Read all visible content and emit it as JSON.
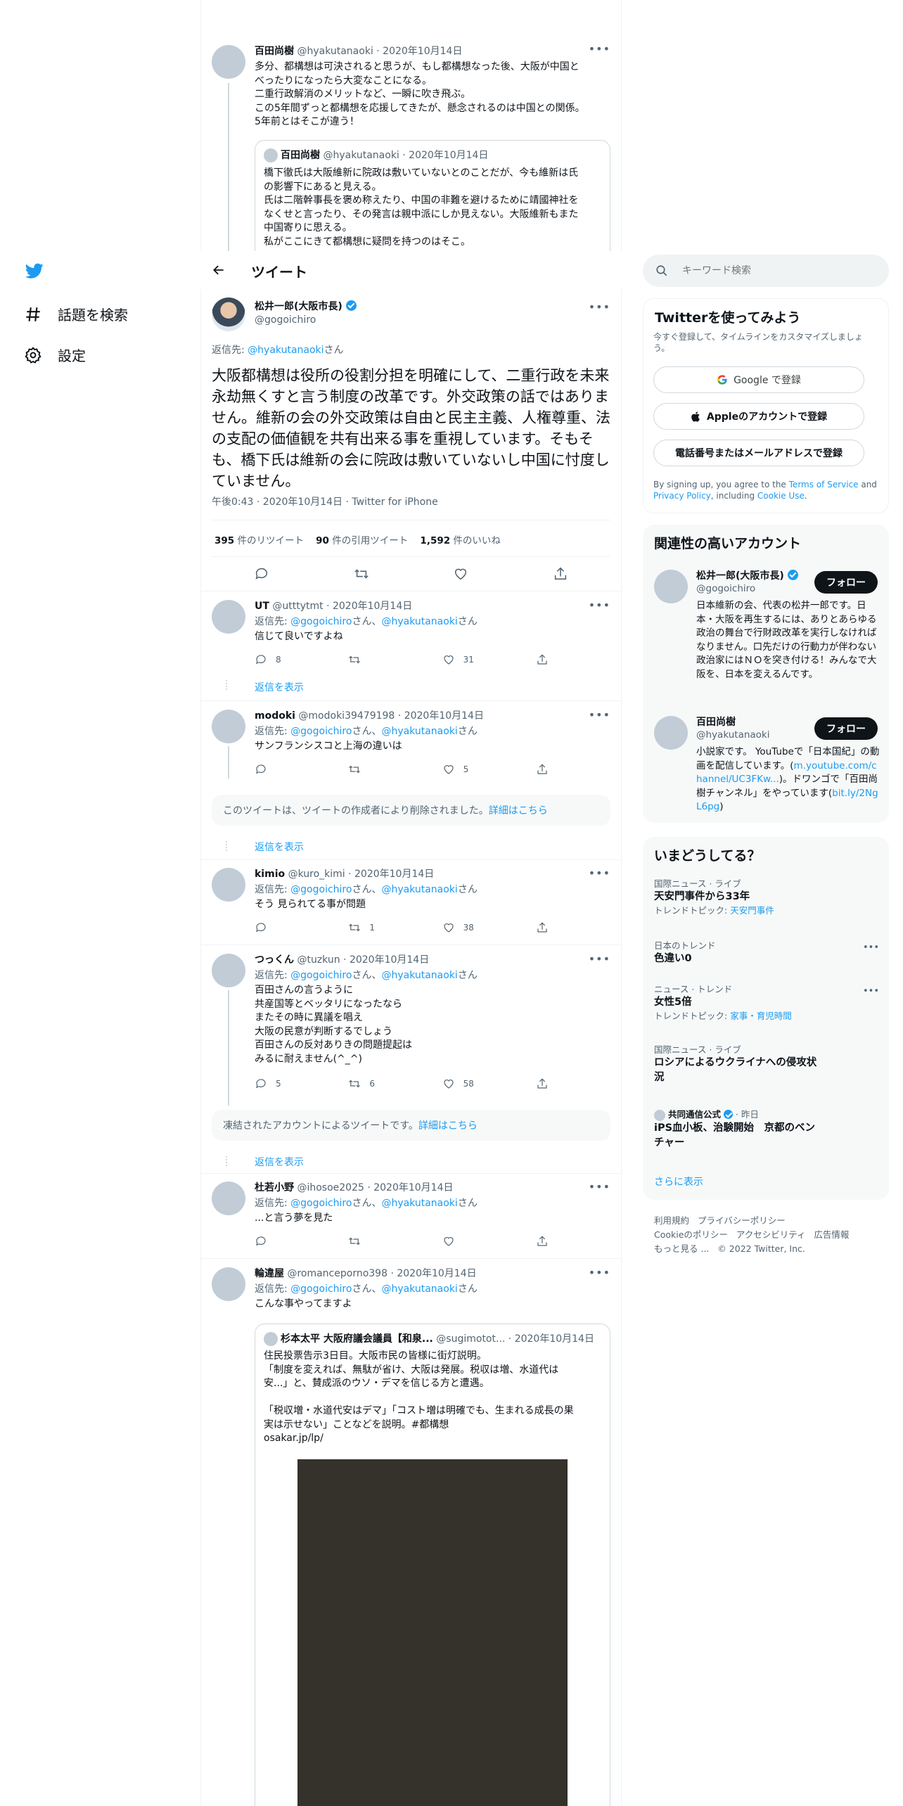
{
  "nav": {
    "explore_label": "話題を検索",
    "settings_label": "設定"
  },
  "header": {
    "title": "ツイート"
  },
  "search": {
    "placeholder": "キーワード検索"
  },
  "parent_tweet": {
    "name": "百田尚樹",
    "handle": "@hyakutanaoki",
    "date": "· 2020年10月14日",
    "lines": [
      "多分、都構想は可決されると思うが、もし都構想なった後、大阪が中国と",
      "べったりになったら大変なことになる。",
      "二重行政解消のメリットなど、一瞬に吹き飛ぶ。",
      "この5年間ずっと都構想を応援してきたが、懸念されるのは中国との関係。",
      "5年前とはそこが違う！"
    ],
    "quote": {
      "name": "百田尚樹",
      "handle": "@hyakutanaoki",
      "date": "· 2020年10月14日",
      "lines": [
        "橋下徹氏は大阪維新に院政は敷いていないとのことだが、今も維新は氏",
        "の影響下にあると見える。",
        "氏は二階幹事長を褒め称えたり、中国の非難を避けるために靖國神社を",
        "なくせと言ったり、その発言は親中派にしか見えない。大阪維新もまた",
        "中国寄りに思える。",
        "私がここにきて都構想に疑問を持つのはそこ。"
      ]
    }
  },
  "main_tweet": {
    "name": "松井一郎(大阪市長)",
    "handle": "@gogoichiro",
    "reply_prefix": "返信先:",
    "reply_to": "@hyakutanaoki",
    "reply_suffix": "さん",
    "text": "大阪都構想は役所の役割分担を明確にして、二重行政を未来永劫無くすと言う制度の改革です。外交政策の話ではありません。維新の会の外交政策は自由と民主主義、人権尊重、法の支配の価値観を共有出来る事を重視しています。そもそも、橋下氏は維新の会に院政は敷いていないし中国に忖度していません。",
    "meta": "午後0:43 · 2020年10月14日 · Twitter for iPhone",
    "retweets": "395",
    "retweets_label": "件のリツイート",
    "quotes": "90",
    "quotes_label": "件の引用ツイート",
    "likes": "1,592",
    "likes_label": "件のいいね"
  },
  "reply_prefix": "返信先:",
  "reply_mention_1": "@gogoichiro",
  "reply_mid": "さん、",
  "reply_mention_2": "@hyakutanaoki",
  "reply_suffix": "さん",
  "show_replies": "返信を表示",
  "replies": [
    {
      "name": "UT",
      "handle": "@utttytmt",
      "date": "· 2020年10月14日",
      "text": "信じて良いですよね",
      "replies": "8",
      "retweets": "",
      "likes": "31"
    },
    {
      "name": "modoki",
      "handle": "@modoki39479198",
      "date": "· 2020年10月14日",
      "text": "サンフランシスコと上海の違いは",
      "replies": "",
      "retweets": "",
      "likes": "5"
    },
    {
      "name": "kimio",
      "handle": "@kuro_kimi",
      "date": "· 2020年10月14日",
      "text": "そう 見られてる事が問題",
      "replies": "",
      "retweets": "1",
      "likes": "38"
    },
    {
      "name": "つっくん",
      "handle": "@tuzkun",
      "date": "· 2020年10月14日",
      "lines": [
        "百田さんの言うように",
        "共産国等とベッタリになったなら",
        "またその時に異議を唱え",
        "大阪の民意が判断するでしょう",
        "百田さんの反対ありきの問題提起は",
        "みるに耐えません(^_^)"
      ],
      "replies": "5",
      "retweets": "6",
      "likes": "58"
    },
    {
      "name": "杜若小野",
      "handle": "@ihosoe2025",
      "date": "· 2020年10月14日",
      "text": "...と言う夢を見た",
      "replies": "",
      "retweets": "",
      "likes": ""
    },
    {
      "name": "輪違屋",
      "handle": "@romanceporno398",
      "date": "· 2020年10月14日",
      "text": "こんな事やってますよ",
      "replies": "",
      "retweets": "",
      "likes": ""
    }
  ],
  "deleted_notice": {
    "text": "このツイートは、ツイートの作成者により削除されました。",
    "link": "詳細はこちら"
  },
  "frozen_notice": {
    "text": "凍結されたアカウントによるツイートです。",
    "link": "詳細はこちら"
  },
  "last_quote": {
    "name": "杉本太平 大阪府議会議員【和泉...",
    "handle": "@sugimotot...",
    "date": "· 2020年10月14日",
    "lines": [
      "住民投票告示3日目。大阪市民の皆様に街灯説明。",
      "「制度を変えれば、無駄が省け、大阪は発展。税収は増、水道代は",
      "安...」と、賛成派のウソ・デマを信じる方と遭遇。",
      "",
      "「税収増・水道代安はデマ」「コスト増は明確でも、生まれる成長の果",
      "実は示せない」ことなどを説明。#都構想",
      "osakar.jp/lp/"
    ]
  },
  "signup": {
    "title": "Twitterを使ってみよう",
    "subtitle": "今すぐ登録して、タイムラインをカスタマイズしましょう。",
    "google": "Google で登録",
    "apple": "Appleのアカウントで登録",
    "phone": "電話番号またはメールアドレスで登録",
    "terms_1": "By signing up, you agree to the ",
    "terms_link": "Terms of Service",
    "terms_2": " and ",
    "privacy_link": "Privacy Policy",
    "terms_3": ", including ",
    "cookie_link": "Cookie Use",
    "terms_4": "."
  },
  "relevant": {
    "title": "関連性の高いアカウント",
    "follow": "フォロー",
    "accounts": [
      {
        "name": "松井一郎(大阪市長)",
        "handle": "@gogoichiro",
        "bio": "日本維新の会、代表の松井一郎です。日本・大阪を再生するには、ありとあらゆる政治の舞台で行財政改革を実行しなければなりません。口先だけの行動力が伴わない政治家にはＮＯを突き付ける！みんなで大阪を、日本を変えるんです。"
      },
      {
        "name": "百田尚樹",
        "handle": "@hyakutanaoki",
        "bio_1": "小説家です。 YouTubeで「日本国紀」の動画を配信しています。(",
        "bio_link_1": "m.youtube.com/channel/UC3FKw...",
        "bio_2": ")。ドワンゴで「百田尚樹チャンネル」をやっています(",
        "bio_link_2": "bit.ly/2NgL6pg",
        "bio_3": ")"
      }
    ]
  },
  "trends": {
    "title": "いまどうしてる？",
    "items": [
      {
        "category": "国際ニュース · ライブ",
        "title": "天安門事件から33年",
        "sub_label": "トレンドトピック: ",
        "sub_link": "天安門事件"
      },
      {
        "category": "日本のトレンド",
        "title": "色違い0"
      },
      {
        "category": "ニュース · トレンド",
        "title": "女性5倍",
        "sub_label": "トレンドトピック: ",
        "sub_link": "家事・育児時間"
      },
      {
        "category": "国際ニュース · ライブ",
        "title": "ロシアによるウクライナへの侵攻状況"
      },
      {
        "source": "共同通信公式",
        "time": "· 昨日",
        "title": "iPS血小板、治験開始　京都のベンチャー"
      }
    ],
    "show_more": "さらに表示"
  },
  "footer": {
    "links": [
      "利用規約",
      "プライバシーポリシー",
      "Cookieのポリシー",
      "アクセシビリティ",
      "広告情報",
      "もっと見る ..."
    ],
    "copyright": "© 2022 Twitter, Inc."
  },
  "colors": {
    "accent": "#1d9bf0",
    "text": "#0f1419",
    "muted": "#536471",
    "border": "#eff3f4"
  }
}
